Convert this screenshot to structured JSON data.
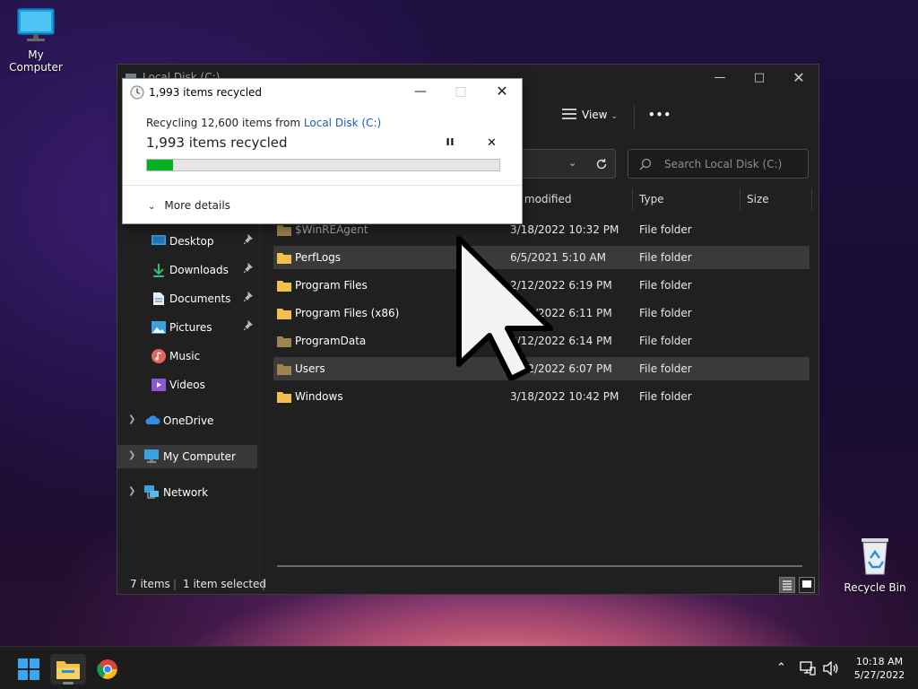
{
  "desktop": {
    "my_computer_label": "My Computer",
    "recycle_bin_label": "Recycle Bin"
  },
  "explorer": {
    "title": "Local Disk (C:)",
    "toolbar": {
      "view_label": "View",
      "more_label": "•••"
    },
    "search_placeholder": "Search Local Disk (C:)",
    "columns": [
      "te modified",
      "Type",
      "Size"
    ],
    "nav": [
      {
        "label": "Desktop",
        "icon": "desktop-icon",
        "pinned": true
      },
      {
        "label": "Downloads",
        "icon": "download-icon",
        "pinned": true
      },
      {
        "label": "Documents",
        "icon": "documents-icon",
        "pinned": true
      },
      {
        "label": "Pictures",
        "icon": "pictures-icon",
        "pinned": true
      },
      {
        "label": "Music",
        "icon": "music-icon",
        "pinned": false
      },
      {
        "label": "Videos",
        "icon": "videos-icon",
        "pinned": false
      },
      {
        "label": "OneDrive",
        "icon": "cloud-icon",
        "pinned": false
      },
      {
        "label": "My Computer",
        "icon": "computer-icon",
        "pinned": false
      },
      {
        "label": "Network",
        "icon": "network-icon",
        "pinned": false
      }
    ],
    "files": [
      {
        "name": "$WinREAgent",
        "date": "3/18/2022 10:32 PM",
        "type": "File folder"
      },
      {
        "name": "PerfLogs",
        "date": "6/5/2021 5:10 AM",
        "type": "File folder"
      },
      {
        "name": "Program Files",
        "date": "2/12/2022 6:19 PM",
        "type": "File folder"
      },
      {
        "name": "Program Files (x86)",
        "date": "2/12/2022 6:11 PM",
        "type": "File folder"
      },
      {
        "name": "ProgramData",
        "date": "2/12/2022 6:14 PM",
        "type": "File folder"
      },
      {
        "name": "Users",
        "date": "2/12/2022 6:07 PM",
        "type": "File folder"
      },
      {
        "name": "Windows",
        "date": "3/18/2022 10:42 PM",
        "type": "File folder"
      }
    ],
    "status": {
      "items": "7 items",
      "selected": "1 item selected"
    }
  },
  "dialog": {
    "title": "1,993 items recycled",
    "line_prefix": "Recycling 12,600 items from ",
    "line_link": "Local Disk (C:)",
    "big_text": "1,993 items recycled",
    "progress_fraction": 0.075,
    "more_details": "More details"
  },
  "taskbar": {
    "time": "10:18 AM",
    "date": "5/27/2022"
  },
  "colors": {
    "progress": "#06b025",
    "folder": "#f3c04a",
    "link": "#1a5fb4"
  }
}
